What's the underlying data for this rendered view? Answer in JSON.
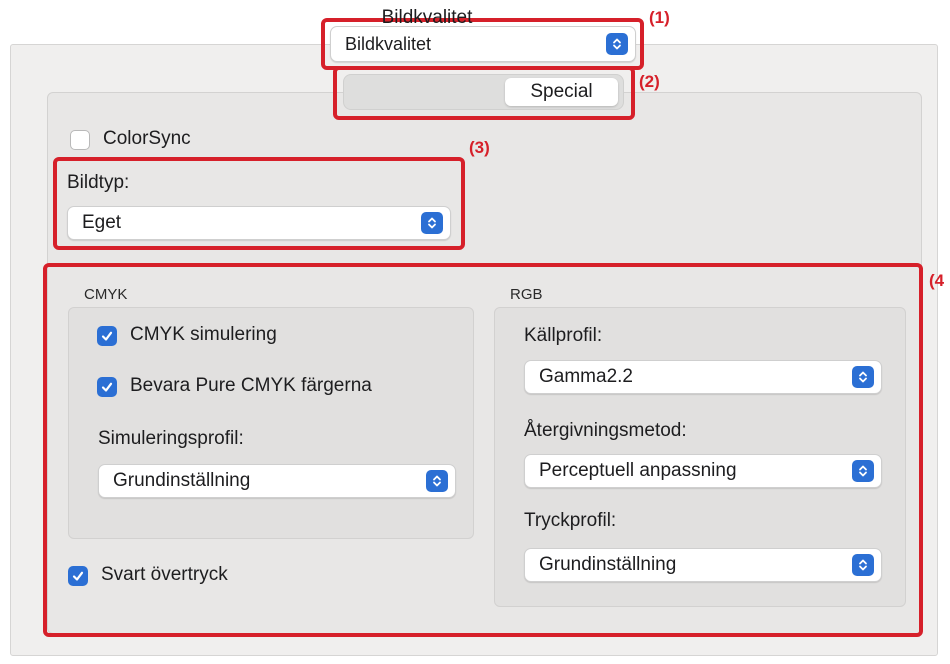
{
  "markers": [
    "(1)",
    "(2)",
    "(3)",
    "(4"
  ],
  "top_popup": {
    "value": "Bildkvalitet"
  },
  "tabs": [
    {
      "label": "Bildkvalitet",
      "active": false
    },
    {
      "label": "Special",
      "active": true
    }
  ],
  "colorsync": {
    "label": "ColorSync",
    "checked": false
  },
  "bildtyp": {
    "label": "Bildtyp:",
    "value": "Eget"
  },
  "cmyk": {
    "title": "CMYK",
    "simulation": {
      "label": "CMYK simulering",
      "checked": true
    },
    "preserve": {
      "label": "Bevara Pure CMYK färgerna",
      "checked": true
    },
    "profile_label": "Simuleringsprofil:",
    "profile_value": "Grundinställning"
  },
  "black_overprint": {
    "label": "Svart övertryck",
    "checked": true
  },
  "rgb": {
    "title": "RGB",
    "source_label": "Källprofil:",
    "source_value": "Gamma2.2",
    "rendering_label": "Återgivningsmetod:",
    "rendering_value": "Perceptuell anpassning",
    "print_label": "Tryckprofil:",
    "print_value": "Grundinställning"
  },
  "colors": {
    "accent": "#2b6fd4",
    "annotation": "#d6202a"
  }
}
